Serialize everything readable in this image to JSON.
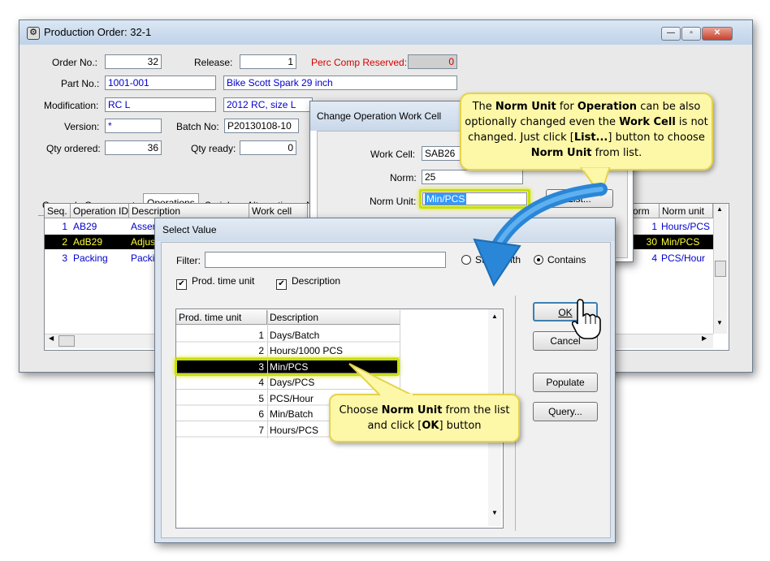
{
  "production_order": {
    "title": "Production Order: 32-1",
    "order_no_label": "Order No.:",
    "order_no": "32",
    "release_label": "Release:",
    "release": "1",
    "perc_comp_label": "Perc Comp Reserved:",
    "perc_comp": "0",
    "part_no_label": "Part No.:",
    "part_no": "1001-001",
    "part_desc": "Bike Scott Spark 29 inch",
    "modification_label": "Modification:",
    "modification": "RC L",
    "modification_desc": "2012 RC, size L",
    "version_label": "Version:",
    "version": "*",
    "batch_no_label": "Batch No:",
    "batch_no": "P20130108-10",
    "qty_ordered_label": "Qty ordered:",
    "qty_ordered": "36",
    "qty_ready_label": "Qty ready:",
    "qty_ready": "0",
    "tabs": [
      "General",
      "Components",
      "Operations",
      "Serials",
      "Alternatives",
      "N"
    ],
    "grid_headers": {
      "seq": "Seq.",
      "op_id": "Operation ID",
      "desc": "Description",
      "work_cell": "Work cell",
      "norm": "orm",
      "norm_unit": "Norm unit"
    },
    "rows": [
      {
        "seq": "1",
        "op_id": "AB29",
        "desc": "Asser",
        "norm": "1",
        "norm_unit": "Hours/PCS"
      },
      {
        "seq": "2",
        "op_id": "AdB29",
        "desc": "Adjus",
        "norm": "30",
        "norm_unit": "Min/PCS"
      },
      {
        "seq": "3",
        "op_id": "Packing",
        "desc": "Packi",
        "norm": "4",
        "norm_unit": "PCS/Hour"
      }
    ]
  },
  "change_op": {
    "title": "Change Operation Work Cell",
    "work_cell_label": "Work Cell:",
    "work_cell": "SAB26",
    "norm_label": "Norm:",
    "norm": "25",
    "norm_unit_label": "Norm Unit:",
    "norm_unit": "Min/PCS",
    "list_button": "List..."
  },
  "select_value": {
    "title": "Select Value",
    "filter_label": "Filter:",
    "filter_value": "",
    "starts_with_label": "Starts with",
    "contains_label": "Contains",
    "prod_time_unit_check": "Prod. time unit",
    "description_check": "Description",
    "col_unit": "Prod. time unit",
    "col_desc": "Description",
    "rows": [
      {
        "unit": "1",
        "desc": "Days/Batch"
      },
      {
        "unit": "2",
        "desc": "Hours/1000 PCS"
      },
      {
        "unit": "3",
        "desc": "Min/PCS"
      },
      {
        "unit": "4",
        "desc": "Days/PCS"
      },
      {
        "unit": "5",
        "desc": "PCS/Hour"
      },
      {
        "unit": "6",
        "desc": "Min/Batch"
      },
      {
        "unit": "7",
        "desc": "Hours/PCS"
      }
    ],
    "ok_button": "OK",
    "cancel_button": "Cancel",
    "populate_button": "Populate",
    "query_button": "Query..."
  },
  "callouts": {
    "top": [
      "The ",
      "Norm Unit",
      " for ",
      "Operation",
      " can be also optionally changed even the ",
      "Work Cell",
      " is not changed. Just click [",
      "List...",
      "] button to choose ",
      "Norm Unit",
      " from list."
    ],
    "bottom": [
      "Choose ",
      "Norm Unit",
      " from the list and click [",
      "OK",
      "] button"
    ]
  },
  "colors": {
    "accent_yellow": "#fdf7a8",
    "highlight_green": "#c8e000",
    "arrow_blue": "#2a86d6",
    "text_blue": "#0000cc",
    "perc_red": "#d40000"
  }
}
